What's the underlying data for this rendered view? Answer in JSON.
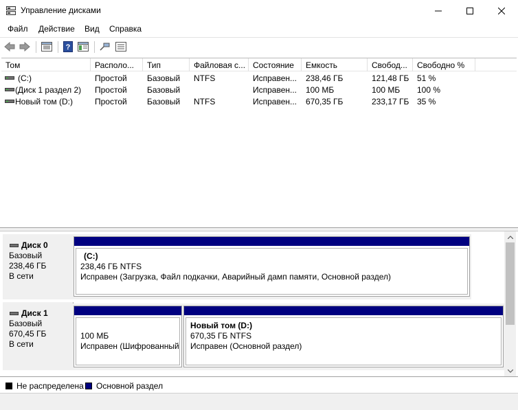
{
  "window": {
    "title": "Управление дисками"
  },
  "menu": [
    "Файл",
    "Действие",
    "Вид",
    "Справка"
  ],
  "toolbar": {
    "icons": [
      "back-icon",
      "forward-icon",
      "properties-icon",
      "help-icon",
      "console-tree-icon",
      "connect-icon",
      "refresh-list-icon"
    ]
  },
  "volumes": {
    "columns": [
      "Том",
      "Располо...",
      "Тип",
      "Файловая с...",
      "Состояние",
      "Емкость",
      "Свобод...",
      "Свободно %"
    ],
    "rows": [
      [
        "(C:)",
        "Простой",
        "Базовый",
        "NTFS",
        "Исправен...",
        "238,46 ГБ",
        "121,48 ГБ",
        "51 %"
      ],
      [
        "(Диск 1 раздел 2)",
        "Простой",
        "Базовый",
        "",
        "Исправен...",
        "100 МБ",
        "100 МБ",
        "100 %"
      ],
      [
        "Новый том (D:)",
        "Простой",
        "Базовый",
        "NTFS",
        "Исправен...",
        "670,35 ГБ",
        "233,17 ГБ",
        "35 %"
      ]
    ]
  },
  "disks": [
    {
      "name": "Диск 0",
      "type": "Базовый",
      "size": "238,46 ГБ",
      "status": "В сети",
      "partitions": [
        {
          "title": "(C:)",
          "line1": "238,46 ГБ NTFS",
          "line2": "Исправен (Загрузка, Файл подкачки, Аварийный дамп памяти, Основной раздел)"
        }
      ]
    },
    {
      "name": "Диск 1",
      "type": "Базовый",
      "size": "670,45 ГБ",
      "status": "В сети",
      "partitions": [
        {
          "title": "",
          "line1": "100 МБ",
          "line2": "Исправен (Шифрованный"
        },
        {
          "title": "Новый том  (D:)",
          "line1": "670,35 ГБ NTFS",
          "line2": "Исправен (Основной раздел)"
        }
      ]
    }
  ],
  "legend": [
    {
      "label": "Не распределена",
      "color": "#000000"
    },
    {
      "label": "Основной раздел",
      "color": "#000080"
    }
  ],
  "colors": {
    "partition_bar": "#000080"
  }
}
